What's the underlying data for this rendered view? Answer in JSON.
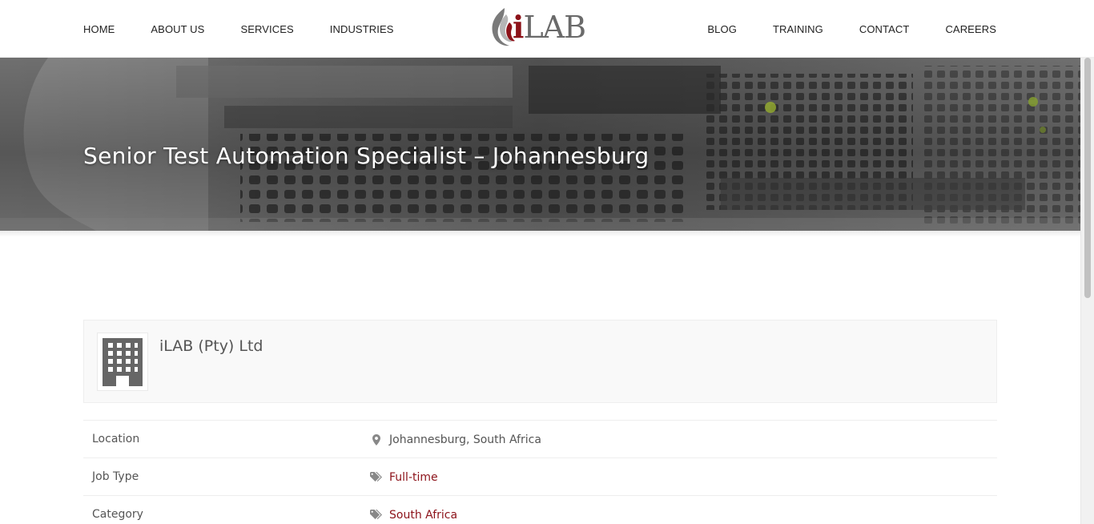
{
  "nav": {
    "left": [
      "HOME",
      "ABOUT US",
      "SERVICES",
      "INDUSTRIES"
    ],
    "right": [
      "BLOG",
      "TRAINING",
      "CONTACT",
      "CAREERS"
    ]
  },
  "logo": {
    "brand_i": "i",
    "brand_rest": "LAB",
    "icon": "flame-logo-icon"
  },
  "hero": {
    "title": "Senior Test Automation Specialist – Johannesburg"
  },
  "company": {
    "name": "iLAB (Pty) Ltd",
    "icon": "building-icon"
  },
  "details": [
    {
      "label": "Location",
      "value": "Johannesburg, South Africa",
      "icon": "map-pin-icon",
      "link": false
    },
    {
      "label": "Job Type",
      "value": "Full-time",
      "icon": "tags-icon",
      "link": true
    },
    {
      "label": "Category",
      "value": "South Africa",
      "icon": "tags-icon",
      "link": true
    }
  ],
  "colors": {
    "accent": "#8c1219",
    "text": "#555555",
    "nav_text": "#222222",
    "border": "#eeeeee"
  }
}
